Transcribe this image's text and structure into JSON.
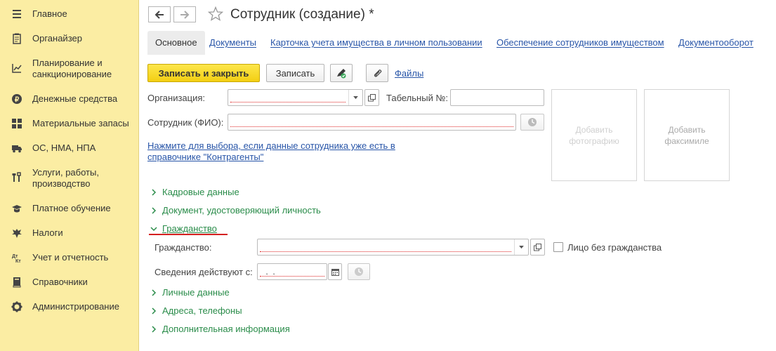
{
  "sidebar": {
    "items": [
      {
        "label": "Главное",
        "icon": "menu-lines-icon"
      },
      {
        "label": "Органайзер",
        "icon": "notepad-icon"
      },
      {
        "label": "Планирование и санкционирование",
        "icon": "chart-planning-icon"
      },
      {
        "label": "Денежные средства",
        "icon": "coin-icon"
      },
      {
        "label": "Материальные запасы",
        "icon": "grid-icon"
      },
      {
        "label": "ОС, НМА, НПА",
        "icon": "truck-icon"
      },
      {
        "label": "Услуги, работы, производство",
        "icon": "tools-icon"
      },
      {
        "label": "Платное обучение",
        "icon": "graduation-cap-icon"
      },
      {
        "label": "Налоги",
        "icon": "eagle-icon"
      },
      {
        "label": "Учет и отчетность",
        "icon": "debit-credit-icon"
      },
      {
        "label": "Справочники",
        "icon": "books-icon"
      },
      {
        "label": "Администрирование",
        "icon": "gear-icon"
      }
    ]
  },
  "header": {
    "title": "Сотрудник (создание) *"
  },
  "tabs": [
    {
      "label": "Основное",
      "active": true
    },
    {
      "label": "Документы"
    },
    {
      "label": "Карточка учета имущества в личном пользовании"
    },
    {
      "label": "Обеспечение сотрудников имуществом"
    },
    {
      "label": "Документооборот"
    }
  ],
  "toolbar": {
    "save_close_label": "Записать и закрыть",
    "save_label": "Записать",
    "files_label": "Файлы"
  },
  "form": {
    "org_label": "Организация:",
    "tab_num_label": "Табельный №:",
    "employee_label": "Сотрудник (ФИО):",
    "hint_link": "Нажмите для выбора, если данные сотрудника уже есть в справочнике \"Контрагенты\"",
    "add_photo": "Добавить фотографию",
    "add_facsimile": "Добавить факсимиле",
    "citizenship_label": "Гражданство:",
    "stateless_label": "Лицо без гражданства",
    "valid_from_label": "Сведения действуют с:",
    "valid_from_value": " .  ."
  },
  "groups": {
    "hr": "Кадровые данные",
    "id_doc": "Документ, удостоверяющий личность",
    "citizenship": "Гражданство",
    "personal": "Личные данные",
    "addresses": "Адреса, телефоны",
    "extra": "Дополнительная информация"
  },
  "colors": {
    "sidebar_bg": "#fbeda3",
    "primary_button": "#f5d31a",
    "link": "#2855a8",
    "group_green": "#2a8c4a",
    "required_red": "#dd2222"
  }
}
